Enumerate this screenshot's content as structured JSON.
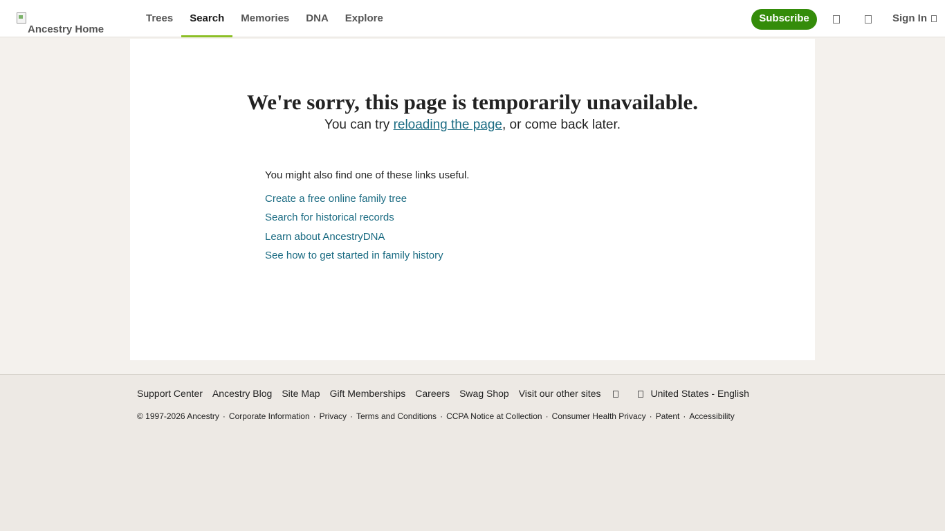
{
  "header": {
    "logo_alt": "Ancestry Home",
    "nav": [
      {
        "label": "Trees"
      },
      {
        "label": "Search",
        "active": true
      },
      {
        "label": "Memories"
      },
      {
        "label": "DNA"
      },
      {
        "label": "Explore"
      }
    ],
    "subscribe_label": "Subscribe",
    "signin_label": "Sign In"
  },
  "main": {
    "headline": "We're sorry, this page is temporarily unavailable.",
    "sub_prefix": "You can try ",
    "sub_link": "reloading the page",
    "sub_suffix": ", or come back later.",
    "useful_label": "You might also find one of these links useful.",
    "links": [
      "Create a free online family tree",
      "Search for historical records",
      "Learn about AncestryDNA",
      "See how to get started in family history"
    ]
  },
  "footer": {
    "links": [
      "Support Center",
      "Ancestry Blog",
      "Site Map",
      "Gift Memberships",
      "Careers",
      "Swag Shop",
      "Visit our other sites"
    ],
    "locale": "United States - English",
    "legal": [
      "© 1997-2026 Ancestry",
      "Corporate Information",
      "Privacy",
      "Terms and Conditions",
      "CCPA Notice at Collection",
      "Consumer Health Privacy",
      "Patent",
      "Accessibility"
    ]
  },
  "colors": {
    "accent_green": "#348c0a",
    "nav_underline": "#8cbf26",
    "link_teal": "#1a6b82"
  }
}
